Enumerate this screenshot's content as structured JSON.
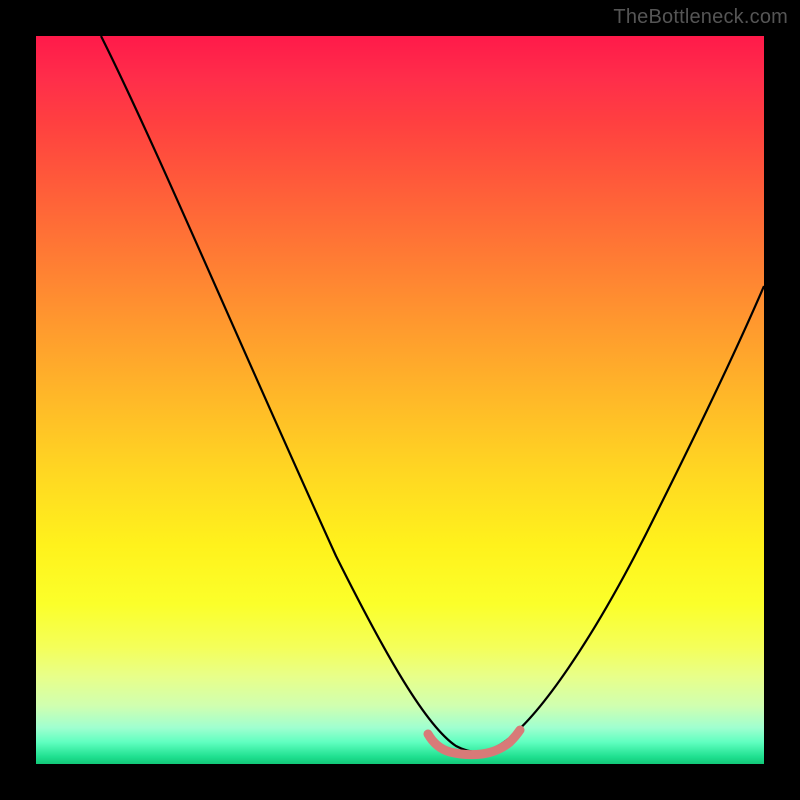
{
  "watermark": "TheBottleneck.com",
  "colors": {
    "frame": "#000000",
    "curve": "#000000",
    "flat_marker": "#d87a78",
    "gradient_top": "#ff1a4a",
    "gradient_bottom": "#12c878"
  },
  "chart_data": {
    "type": "line",
    "title": "",
    "xlabel": "",
    "ylabel": "",
    "xlim": [
      0,
      100
    ],
    "ylim": [
      0,
      100
    ],
    "grid": false,
    "legend": false,
    "series": [
      {
        "name": "bottleneck-curve",
        "x": [
          9,
          15,
          20,
          25,
          30,
          35,
          40,
          45,
          50,
          54,
          57,
          59,
          61,
          63,
          66,
          70,
          75,
          80,
          85,
          90,
          95,
          100
        ],
        "y": [
          100,
          88,
          78,
          68,
          58,
          48,
          38,
          28,
          18,
          10,
          5,
          3,
          2,
          3,
          6,
          12,
          21,
          30,
          39,
          48,
          57,
          66
        ]
      },
      {
        "name": "optimal-flat-region",
        "x": [
          54,
          56,
          58,
          60,
          62,
          64,
          66
        ],
        "y": [
          4.5,
          3.2,
          2.6,
          2.4,
          2.6,
          3.2,
          4.5
        ]
      }
    ],
    "annotations": []
  }
}
